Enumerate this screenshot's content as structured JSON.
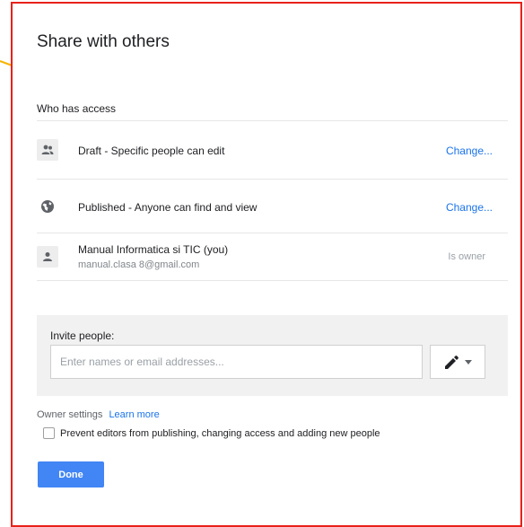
{
  "dialog": {
    "title": "Share with others",
    "section_label": "Who has access"
  },
  "access_rows": [
    {
      "icon": "people-icon",
      "text": "Draft - Specific people can edit",
      "action": "Change..."
    },
    {
      "icon": "globe-icon",
      "text": "Published - Anyone can find and view",
      "action": "Change..."
    },
    {
      "icon": "person-icon",
      "name": "Manual Informatica si TIC (you)",
      "email": "manual.clasa 8@gmail.com",
      "role": "Is owner"
    }
  ],
  "invite": {
    "label": "Invite people:",
    "placeholder": "Enter names or email addresses...",
    "permission_icon": "pencil-icon"
  },
  "owner_settings": {
    "label": "Owner settings",
    "learn_more": "Learn more",
    "checkbox_label": "Prevent editors from publishing, changing access and adding new people",
    "checked": false
  },
  "done_label": "Done",
  "colors": {
    "accent": "#4285f4",
    "link": "#1a73e8",
    "border_highlight": "#e8211a",
    "annotation_arrow": "#f4b400"
  }
}
